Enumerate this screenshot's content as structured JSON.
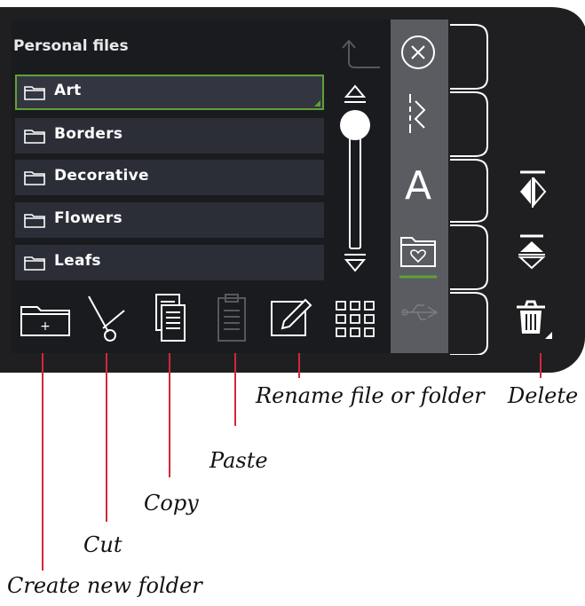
{
  "panel": {
    "title": "Personal files"
  },
  "folders": [
    {
      "label": "Art",
      "selected": true
    },
    {
      "label": "Borders",
      "selected": false
    },
    {
      "label": "Decorative",
      "selected": false
    },
    {
      "label": "Flowers",
      "selected": false
    },
    {
      "label": "Leafs",
      "selected": false
    }
  ],
  "toolbar": {
    "icons": [
      "new-folder-icon",
      "cut-icon",
      "copy-icon",
      "paste-icon",
      "rename-icon",
      "grid-view-icon"
    ]
  },
  "sidebar": {
    "icons": [
      "close-icon",
      "stitch-icon",
      "font-icon",
      "personal-files-icon",
      "usb-icon"
    ]
  },
  "right_icons": [
    "mirror-side-icon",
    "mirror-end-icon",
    "delete-icon"
  ],
  "callouts": {
    "create_new_folder": "Create new folder",
    "cut": "Cut",
    "copy": "Copy",
    "paste": "Paste",
    "rename": "Rename file or folder",
    "delete": "Delete"
  },
  "colors": {
    "accent_green": "#5fa13a",
    "callout_red": "#d1283a",
    "panel_bg": "#1a1b1f",
    "row_bg": "#2c2e37",
    "sidebar_bg": "#5a5c62"
  }
}
